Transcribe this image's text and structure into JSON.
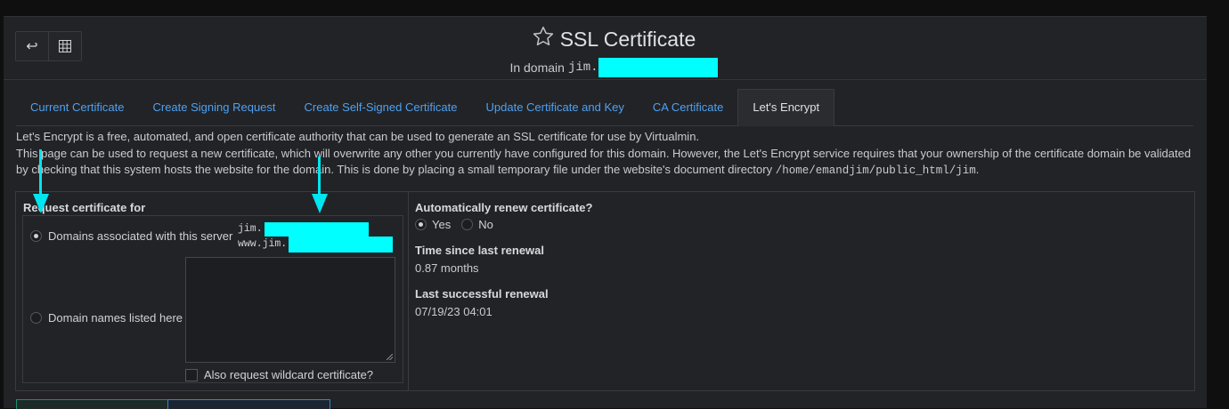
{
  "header": {
    "back_icon": "return-arrow",
    "grid_icon": "grid-icon",
    "star_icon": "star-outline",
    "title": "SSL Certificate",
    "subtitle_prefix": "In domain",
    "domain_prefix": "jim."
  },
  "tabs": [
    {
      "label": "Current Certificate"
    },
    {
      "label": "Create Signing Request"
    },
    {
      "label": "Create Self-Signed Certificate"
    },
    {
      "label": "Update Certificate and Key"
    },
    {
      "label": "CA Certificate"
    },
    {
      "label": "Let's Encrypt"
    }
  ],
  "description": {
    "line1": "Let's Encrypt is a free, automated, and open certificate authority that can be used to generate an SSL certificate for use by Virtualmin.",
    "line2": "This page can be used to request a new certificate, which will overwrite any other you currently have configured for this domain. However, the Let's Encrypt service requires that your ownership of the certificate domain be validated by checking that this system hosts the website for the domain. This is done by placing a small temporary file under the website's document directory",
    "path": "/home/emandjim/public_html/jim",
    "end": "."
  },
  "form": {
    "request_label": "Request certificate for",
    "option_server": "Domains associated with this server",
    "domain1_prefix": "jim.",
    "domain2_prefix": "www.jim.",
    "option_listed": "Domain names listed here",
    "domain_names_value": "",
    "wildcard_label": "Also request wildcard certificate?",
    "renew_label": "Automatically renew certificate?",
    "renew_yes": "Yes",
    "renew_no": "No",
    "since_label": "Time since last renewal",
    "since_value": "0.87 months",
    "last_label": "Last successful renewal",
    "last_value": "07/19/23 04:01"
  },
  "colors": {
    "accent_link": "#4ea1f3",
    "annotation": "#00e5ef",
    "redaction": "#00ffff"
  }
}
